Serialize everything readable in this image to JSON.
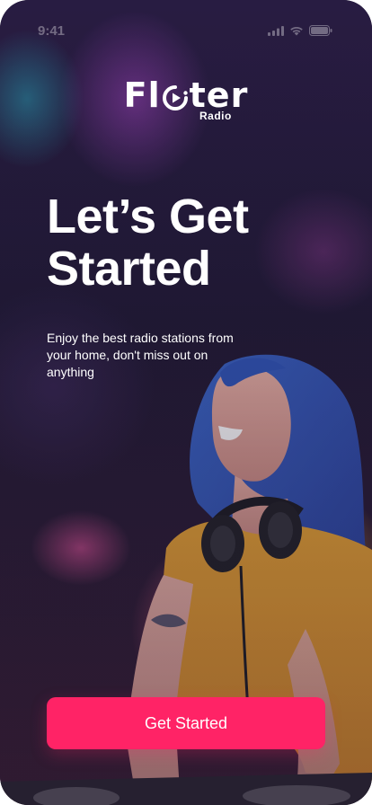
{
  "status_bar": {
    "time": "9:41",
    "icons": [
      "cellular-signal-icon",
      "wifi-icon",
      "battery-icon"
    ]
  },
  "logo": {
    "word_start": "Fl",
    "word_end": "ter",
    "subtitle": "Radio",
    "play_icon": "play-circle-icon"
  },
  "hero": {
    "headline_line1": "Let’s Get",
    "headline_line2": "Started",
    "subtitle": "Enjoy the best radio stations from your home, don't miss out on anything"
  },
  "cta": {
    "label": "Get Started",
    "color": "#ff2366"
  },
  "background": {
    "image": "dj-with-headphones-photo"
  }
}
